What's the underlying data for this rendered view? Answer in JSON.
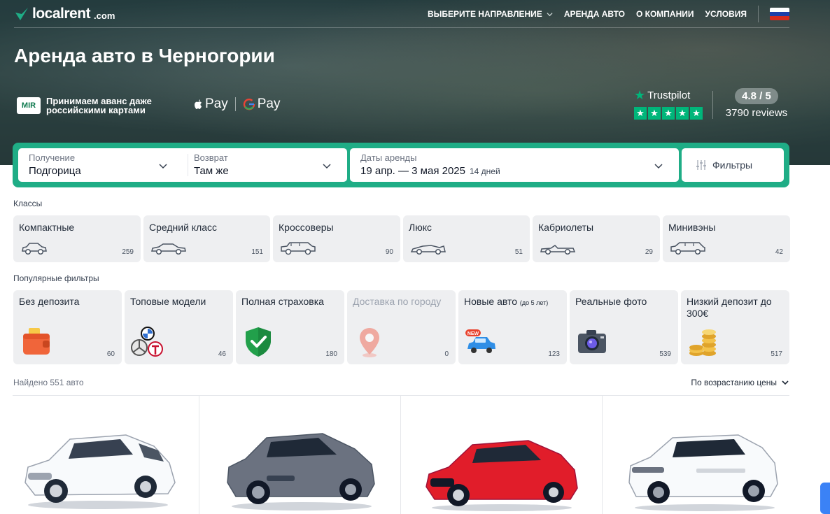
{
  "header": {
    "logo_text": "localrent",
    "logo_suffix": ".com",
    "nav": [
      {
        "label": "ВЫБЕРИТЕ НАПРАВЛЕНИЕ"
      },
      {
        "label": "АРЕНДА АВТО"
      },
      {
        "label": "О КОМПАНИИ"
      },
      {
        "label": "УСЛОВИЯ"
      }
    ],
    "language_flag": "russian-flag-icon"
  },
  "hero": {
    "title": "Аренда авто в Черногории",
    "mir_logo": "MIR",
    "mir_text": "Принимаем аванс даже российскими картами",
    "apple_pay": "Pay",
    "google_pay": "Pay",
    "trustpilot": "Trustpilot",
    "rating": "4.8 / 5",
    "reviews": "3790 reviews"
  },
  "search": {
    "pickup_label": "Получение",
    "pickup_value": "Подгорица",
    "return_label": "Возврат",
    "return_value": "Там же",
    "dates_label": "Даты аренды",
    "dates_value": "19 апр. — 3 мая 2025",
    "dates_days": "14 дней",
    "filters_label": "Фильтры"
  },
  "classes": {
    "label": "Классы",
    "items": [
      {
        "name": "Компактные",
        "count": "259",
        "icon": "compact-car-icon"
      },
      {
        "name": "Средний класс",
        "count": "151",
        "icon": "sedan-car-icon"
      },
      {
        "name": "Кроссоверы",
        "count": "90",
        "icon": "suv-car-icon"
      },
      {
        "name": "Люкс",
        "count": "51",
        "icon": "sports-car-icon"
      },
      {
        "name": "Кабриолеты",
        "count": "29",
        "icon": "convertible-car-icon"
      },
      {
        "name": "Минивэны",
        "count": "42",
        "icon": "minivan-car-icon"
      }
    ]
  },
  "popular_filters": {
    "label": "Популярные фильтры",
    "items": [
      {
        "name": "Без депозита",
        "count": "60",
        "icon": "wallet-icon"
      },
      {
        "name": "Топовые модели",
        "count": "46",
        "icon": "car-brands-icon"
      },
      {
        "name": "Полная страховка",
        "count": "180",
        "icon": "shield-check-icon"
      },
      {
        "name": "Доставка по городу",
        "count": "0",
        "icon": "location-pin-icon"
      },
      {
        "name": "Новые авто",
        "tag": "(до 5 лет)",
        "count": "123",
        "icon": "new-car-icon"
      },
      {
        "name": "Реальные фото",
        "count": "539",
        "icon": "camera-icon"
      },
      {
        "name": "Низкий депозит до 300€",
        "count": "517",
        "icon": "coins-icon"
      }
    ]
  },
  "results": {
    "found": "Найдено 551 авто",
    "sort": "По возрастанию цены"
  },
  "colors": {
    "accent": "#1fad86",
    "trustpilot": "#00b67a"
  }
}
